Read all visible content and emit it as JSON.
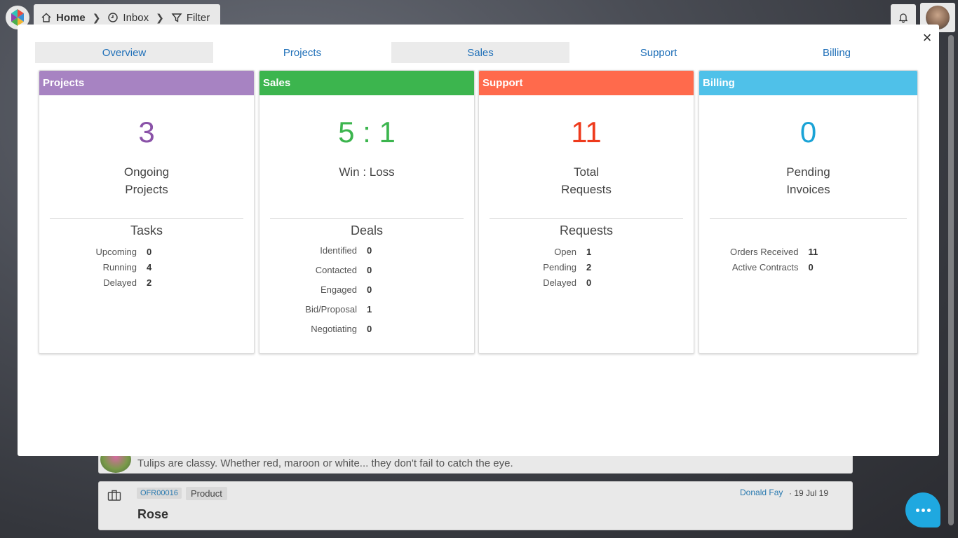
{
  "breadcrumb": {
    "home": "Home",
    "inbox": "Inbox",
    "filter": "Filter"
  },
  "feed": {
    "tulip_text": "Tulips are classy. Whether red, maroon or white... they don't fail to catch the eye.",
    "offer_id": "OFR00016",
    "offer_type": "Product",
    "offer_author": "Donald Fay",
    "offer_date": "· 19 Jul 19",
    "offer_title": "Rose"
  },
  "modal": {
    "close_label": "×",
    "tabs": [
      {
        "label": "Overview"
      },
      {
        "label": "Projects"
      },
      {
        "label": "Sales"
      },
      {
        "label": "Support"
      },
      {
        "label": "Billing"
      }
    ],
    "cards": {
      "projects": {
        "title": "Projects",
        "color": "#a783c2",
        "value_color": "#8a52a8",
        "value": "3",
        "label_line1": "Ongoing",
        "label_line2": "Projects",
        "section": "Tasks",
        "rows": [
          {
            "label": "Upcoming",
            "value": "0"
          },
          {
            "label": "Running",
            "value": "4"
          },
          {
            "label": "Delayed",
            "value": "2"
          }
        ]
      },
      "sales": {
        "title": "Sales",
        "color": "#3cb54e",
        "value_color": "#3cb54e",
        "value": "5 : 1",
        "label_line1": "Win : Loss",
        "section": "Deals",
        "rows": [
          {
            "label": "Identified",
            "value": "0"
          },
          {
            "label": "Contacted",
            "value": "0"
          },
          {
            "label": "Engaged",
            "value": "0"
          },
          {
            "label": "Bid/Proposal",
            "value": "1"
          },
          {
            "label": "Negotiating",
            "value": "0"
          }
        ]
      },
      "support": {
        "title": "Support",
        "color": "#ff6a4c",
        "value_color": "#ee3a1c",
        "value": "11",
        "label_line1": "Total",
        "label_line2": "Requests",
        "section": "Requests",
        "rows": [
          {
            "label": "Open",
            "value": "1"
          },
          {
            "label": "Pending",
            "value": "2"
          },
          {
            "label": "Delayed",
            "value": "0"
          }
        ]
      },
      "billing": {
        "title": "Billing",
        "color": "#4fc1e9",
        "value_color": "#1aa3d6",
        "value": "0",
        "label_line1": "Pending",
        "label_line2": "Invoices",
        "rows": [
          {
            "label": "Orders Received",
            "value": "11"
          },
          {
            "label": "Active Contracts",
            "value": "0"
          }
        ]
      }
    }
  }
}
